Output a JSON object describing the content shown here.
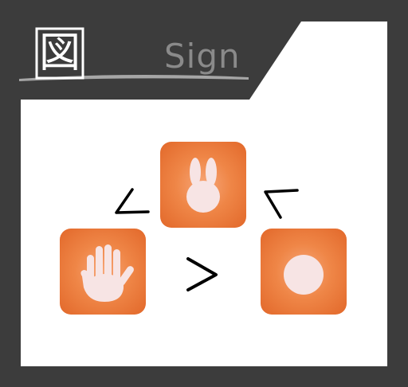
{
  "header": {
    "kanji_glyph": "図",
    "title": "Sign"
  },
  "tiles": [
    {
      "name": "rabbit",
      "icon": "rabbit-head-icon"
    },
    {
      "name": "hand",
      "icon": "open-hand-icon"
    },
    {
      "name": "ball",
      "icon": "circle-ball-icon"
    }
  ],
  "relations": {
    "left": "<",
    "center": ">",
    "right": "<"
  },
  "colors": {
    "background": "#3c3c3c",
    "card": "#ffffff",
    "tile_orange": "#e8733a",
    "icon_fill": "#f7e4e4",
    "title_gray": "#8a8a8a"
  }
}
